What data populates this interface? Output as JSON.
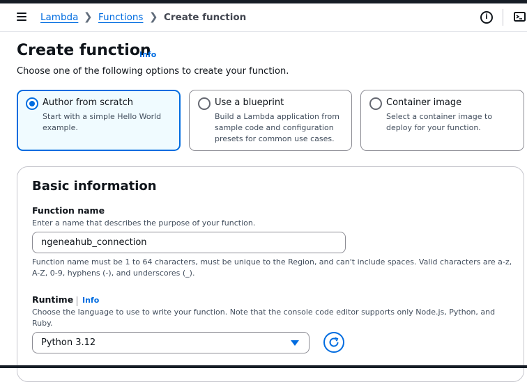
{
  "breadcrumb": {
    "items": [
      "Lambda",
      "Functions",
      "Create function"
    ]
  },
  "page": {
    "title": "Create function",
    "info_label": "Info",
    "subtitle": "Choose one of the following options to create your function."
  },
  "options": [
    {
      "title": "Author from scratch",
      "description": "Start with a simple Hello World example.",
      "selected": true
    },
    {
      "title": "Use a blueprint",
      "description": "Build a Lambda application from sample code and configuration presets for common use cases.",
      "selected": false
    },
    {
      "title": "Container image",
      "description": "Select a container image to deploy for your function.",
      "selected": false
    }
  ],
  "basic_info": {
    "title": "Basic information",
    "function_name": {
      "label": "Function name",
      "description": "Enter a name that describes the purpose of your function.",
      "value": "ngeneahub_connection",
      "constraint": "Function name must be 1 to 64 characters, must be unique to the Region, and can't include spaces. Valid characters are a-z, A-Z, 0-9, hyphens (-), and underscores (_)."
    },
    "runtime": {
      "label": "Runtime",
      "info_label": "Info",
      "description": "Choose the language to use to write your function. Note that the console code editor supports only Node.js, Python, and Ruby.",
      "value": "Python 3.12"
    }
  },
  "colors": {
    "accent": "#006ce0",
    "selected_bg": "#f0fbff",
    "topbar": "#161d26"
  },
  "icons": {
    "menu": "hamburger-icon",
    "info": "info-circle-icon",
    "shell": "cloudshell-icon",
    "refresh": "refresh-icon",
    "dropdown": "caret-down-icon"
  }
}
